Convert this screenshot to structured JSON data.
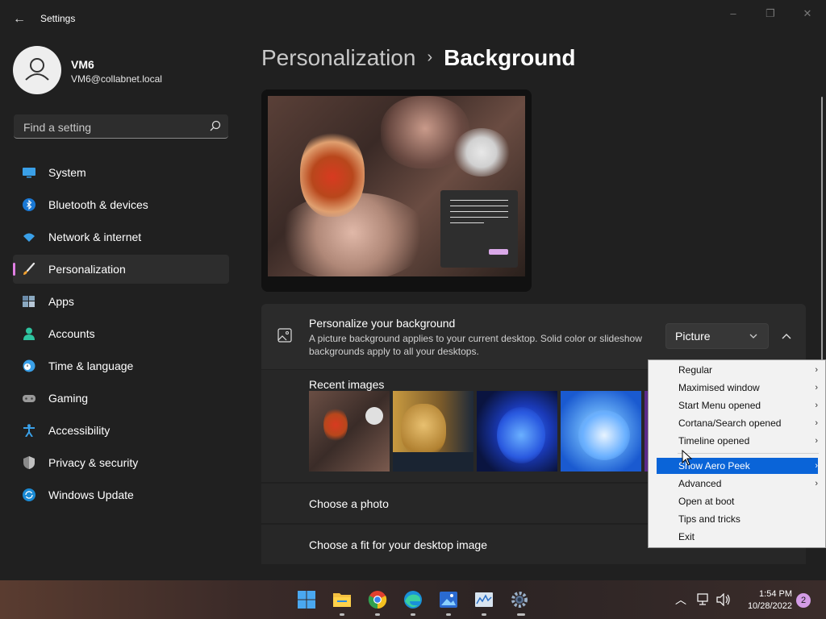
{
  "window": {
    "title": "Settings",
    "back_label": "←",
    "minimize_label": "–",
    "maximize_label": "❐",
    "close_label": "✕"
  },
  "user": {
    "name": "VM6",
    "email": "VM6@collabnet.local"
  },
  "search": {
    "placeholder": "Find a setting"
  },
  "nav": {
    "items": [
      {
        "label": "System",
        "icon": "monitor-icon"
      },
      {
        "label": "Bluetooth & devices",
        "icon": "bluetooth-icon"
      },
      {
        "label": "Network & internet",
        "icon": "wifi-icon"
      },
      {
        "label": "Personalization",
        "icon": "brush-icon",
        "active": true
      },
      {
        "label": "Apps",
        "icon": "apps-icon"
      },
      {
        "label": "Accounts",
        "icon": "person-icon"
      },
      {
        "label": "Time & language",
        "icon": "clock-globe-icon"
      },
      {
        "label": "Gaming",
        "icon": "gamepad-icon"
      },
      {
        "label": "Accessibility",
        "icon": "accessibility-icon"
      },
      {
        "label": "Privacy & security",
        "icon": "shield-icon"
      },
      {
        "label": "Windows Update",
        "icon": "update-icon"
      }
    ]
  },
  "breadcrumb": {
    "parent": "Personalization",
    "separator": "›",
    "current": "Background"
  },
  "background_card": {
    "title": "Personalize your background",
    "description": "A picture background applies to your current desktop. Solid color or slideshow backgrounds apply to all your desktops.",
    "select_value": "Picture"
  },
  "recent_images": {
    "title": "Recent images"
  },
  "choose_photo": {
    "title": "Choose a photo"
  },
  "choose_fit": {
    "title": "Choose a fit for your desktop image"
  },
  "context_menu": {
    "items": [
      {
        "label": "Regular",
        "arrow": "›"
      },
      {
        "label": "Maximised window",
        "arrow": "›"
      },
      {
        "label": "Start Menu opened",
        "arrow": "›"
      },
      {
        "label": "Cortana/Search opened",
        "arrow": "›"
      },
      {
        "label": "Timeline opened",
        "arrow": "›"
      },
      {
        "label": "Show Aero Peek",
        "arrow": "›",
        "highlighted": true
      },
      {
        "label": "Advanced",
        "arrow": "›"
      },
      {
        "label": "Open at boot",
        "arrow": ""
      },
      {
        "label": "Tips and tricks",
        "arrow": ""
      },
      {
        "label": "Exit",
        "arrow": ""
      }
    ]
  },
  "taskbar": {
    "apps": [
      "start-icon",
      "file-explorer-icon",
      "chrome-icon",
      "edge-icon",
      "photos-icon",
      "resource-monitor-icon",
      "settings-icon"
    ],
    "tray_chevron": "︿",
    "time": "1:54 PM",
    "date": "10/28/2022",
    "notification_count": "2"
  },
  "colors": {
    "accent": "#e07fe3",
    "highlight": "#0a64d8",
    "background": "#202020",
    "card": "#2b2b2b"
  }
}
